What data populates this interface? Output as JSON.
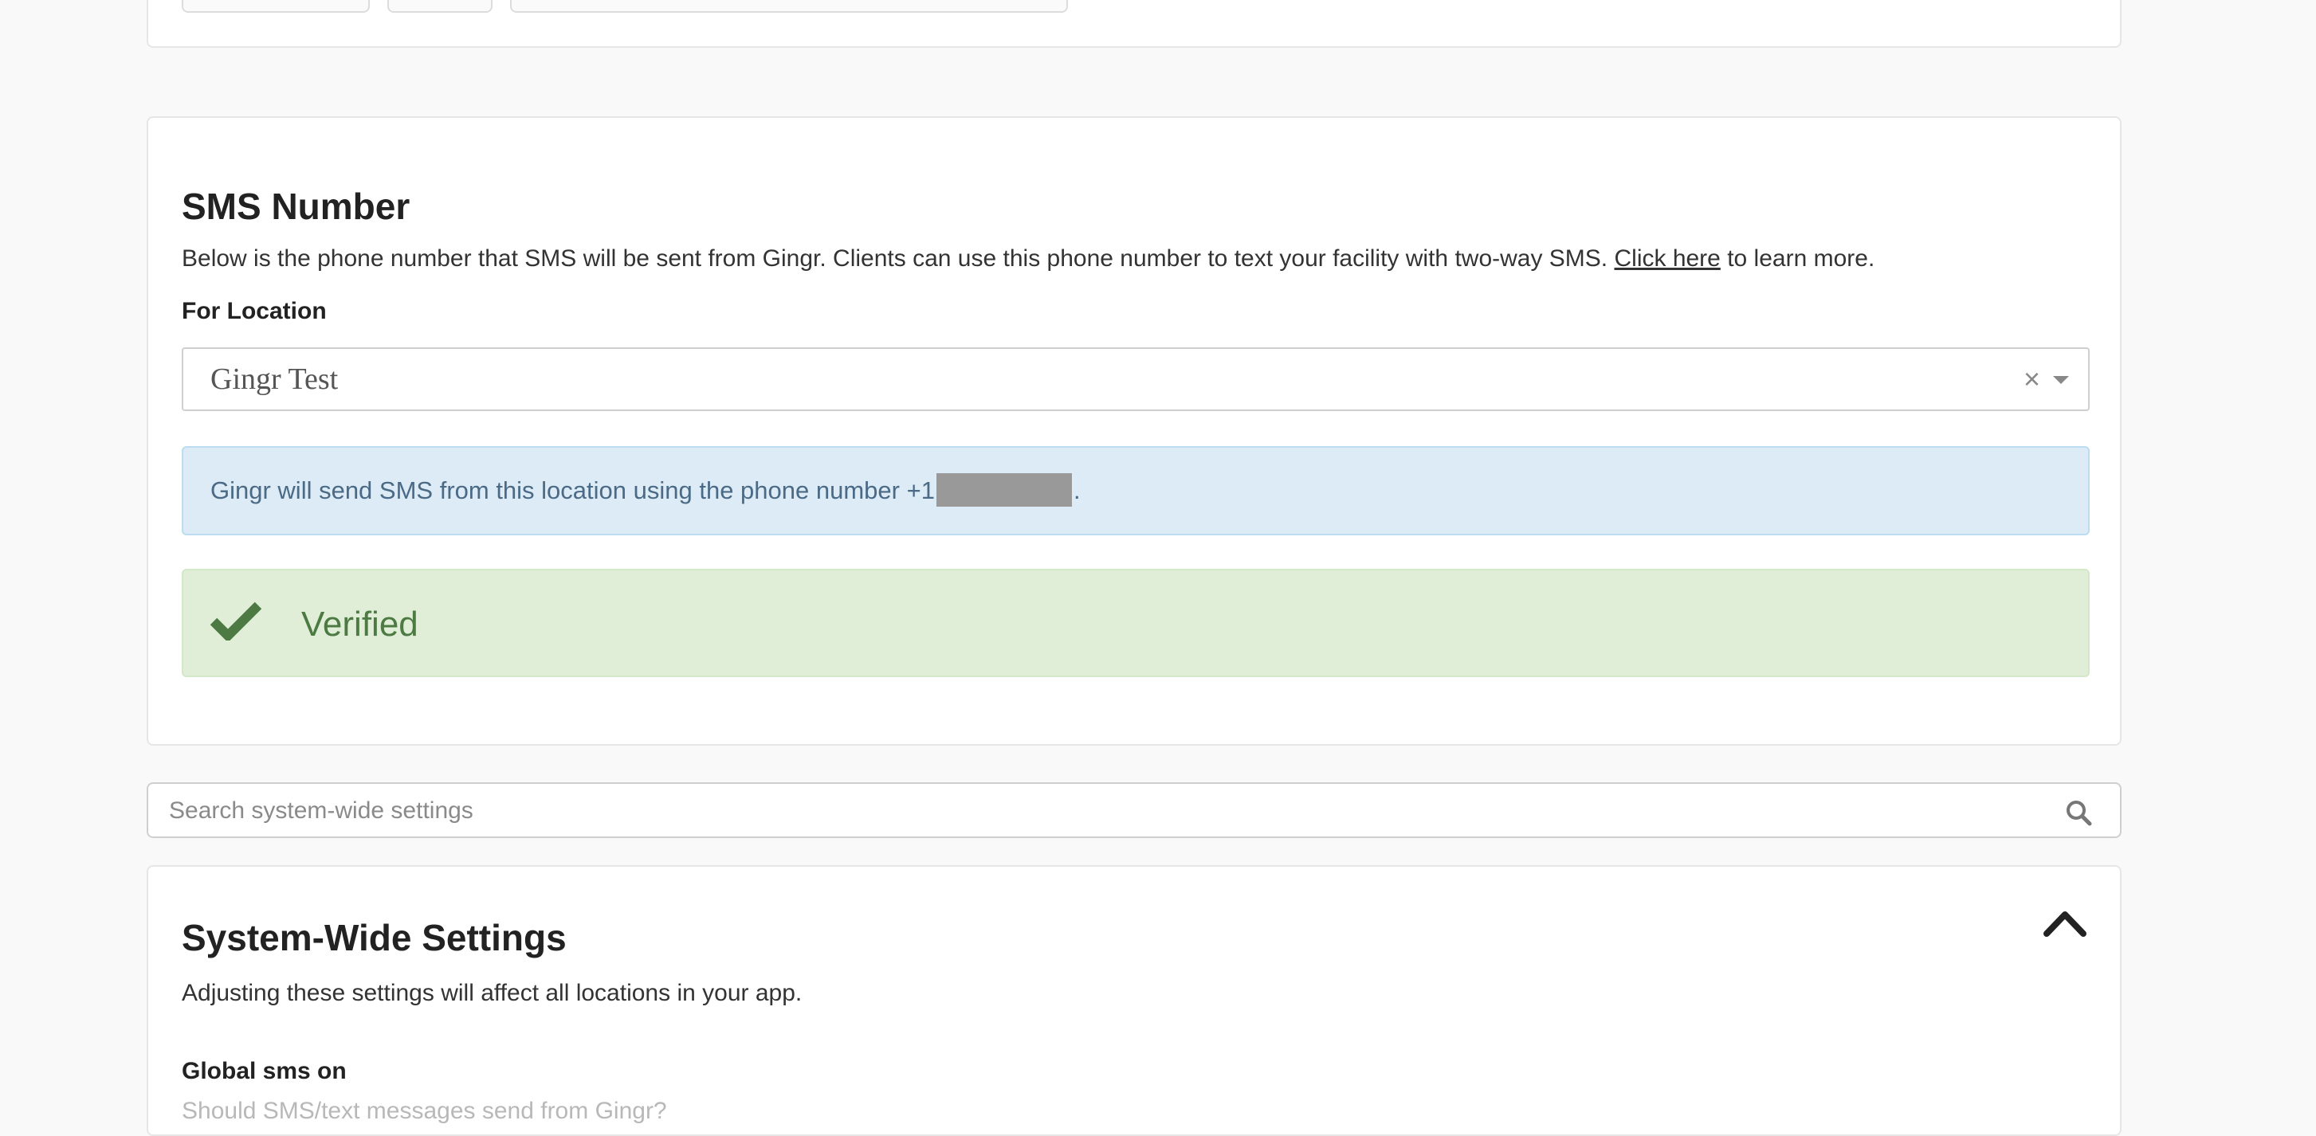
{
  "sms_section": {
    "title": "SMS Number",
    "description_before": "Below is the phone number that SMS will be sent from Gingr. Clients can use this phone number to text your facility with two-way SMS. ",
    "link_text": "Click here",
    "description_after": " to learn more.",
    "location_label": "For Location",
    "location_selected": "Gingr Test",
    "clear_symbol": "×",
    "info_before": "Gingr will send SMS from this location using the phone number +1",
    "info_after": ".",
    "status": "Verified",
    "status_color": "#4d7a42"
  },
  "search": {
    "placeholder": "Search system-wide settings"
  },
  "system_section": {
    "title": "System-Wide Settings",
    "description": "Adjusting these settings will affect all locations in your app.",
    "setting_label": "Global sms on",
    "setting_help": "Should SMS/text messages send from Gingr?"
  },
  "icons": {
    "check": "check-icon",
    "search": "search-icon",
    "collapse": "chevron-up-icon"
  },
  "colors": {
    "info_bg": "#dcebf5",
    "success_bg": "#e0eed8"
  }
}
